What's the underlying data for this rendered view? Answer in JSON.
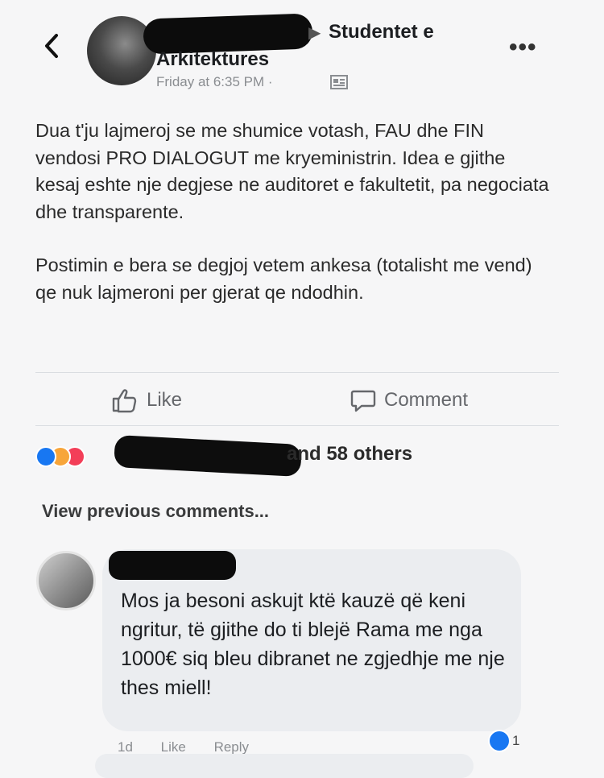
{
  "post": {
    "group_name_line1": "Studentet e",
    "group_name_line2": "Arkitektures",
    "timestamp": "Friday at 6:35 PM ·",
    "paragraph1": "Dua t'ju lajmeroj se me shumice votash, FAU dhe FIN vendosi PRO DIALOGUT me kryeministrin. Idea e gjithe kesaj eshte nje degjese ne auditoret e fakultetit, pa negociata dhe transparente.",
    "paragraph2": "Postimin e bera se degjoj vetem ankesa (totalisht me vend) qe nuk lajmeroni per gjerat qe ndodhin."
  },
  "actions": {
    "like_label": "Like",
    "comment_label": "Comment"
  },
  "reactions": {
    "others_text": "and 58 others"
  },
  "comments": {
    "view_previous": "View previous comments...",
    "items": [
      {
        "text": "Mos ja besoni askujt ktë kauzë që keni ngritur, të gjithe do ti blejë Rama me nga 1000€ siq bleu dibranet ne zgjedhje me nje thes miell!",
        "time": "1d",
        "like_label": "Like",
        "reply_label": "Reply",
        "reaction_count": "1"
      }
    ]
  },
  "icons": {
    "back": "chevron-left-icon",
    "more": "more-options-icon",
    "privacy": "group-privacy-icon",
    "like": "thumbs-up-icon",
    "comment": "comment-bubble-icon"
  },
  "colors": {
    "background": "#f6f6f7",
    "reaction_like": "#1877f2",
    "reaction_love": "#f33e58",
    "reaction_angry": "#f7a53a",
    "bubble": "#ebedf0",
    "muted_text": "#8a8d91"
  }
}
